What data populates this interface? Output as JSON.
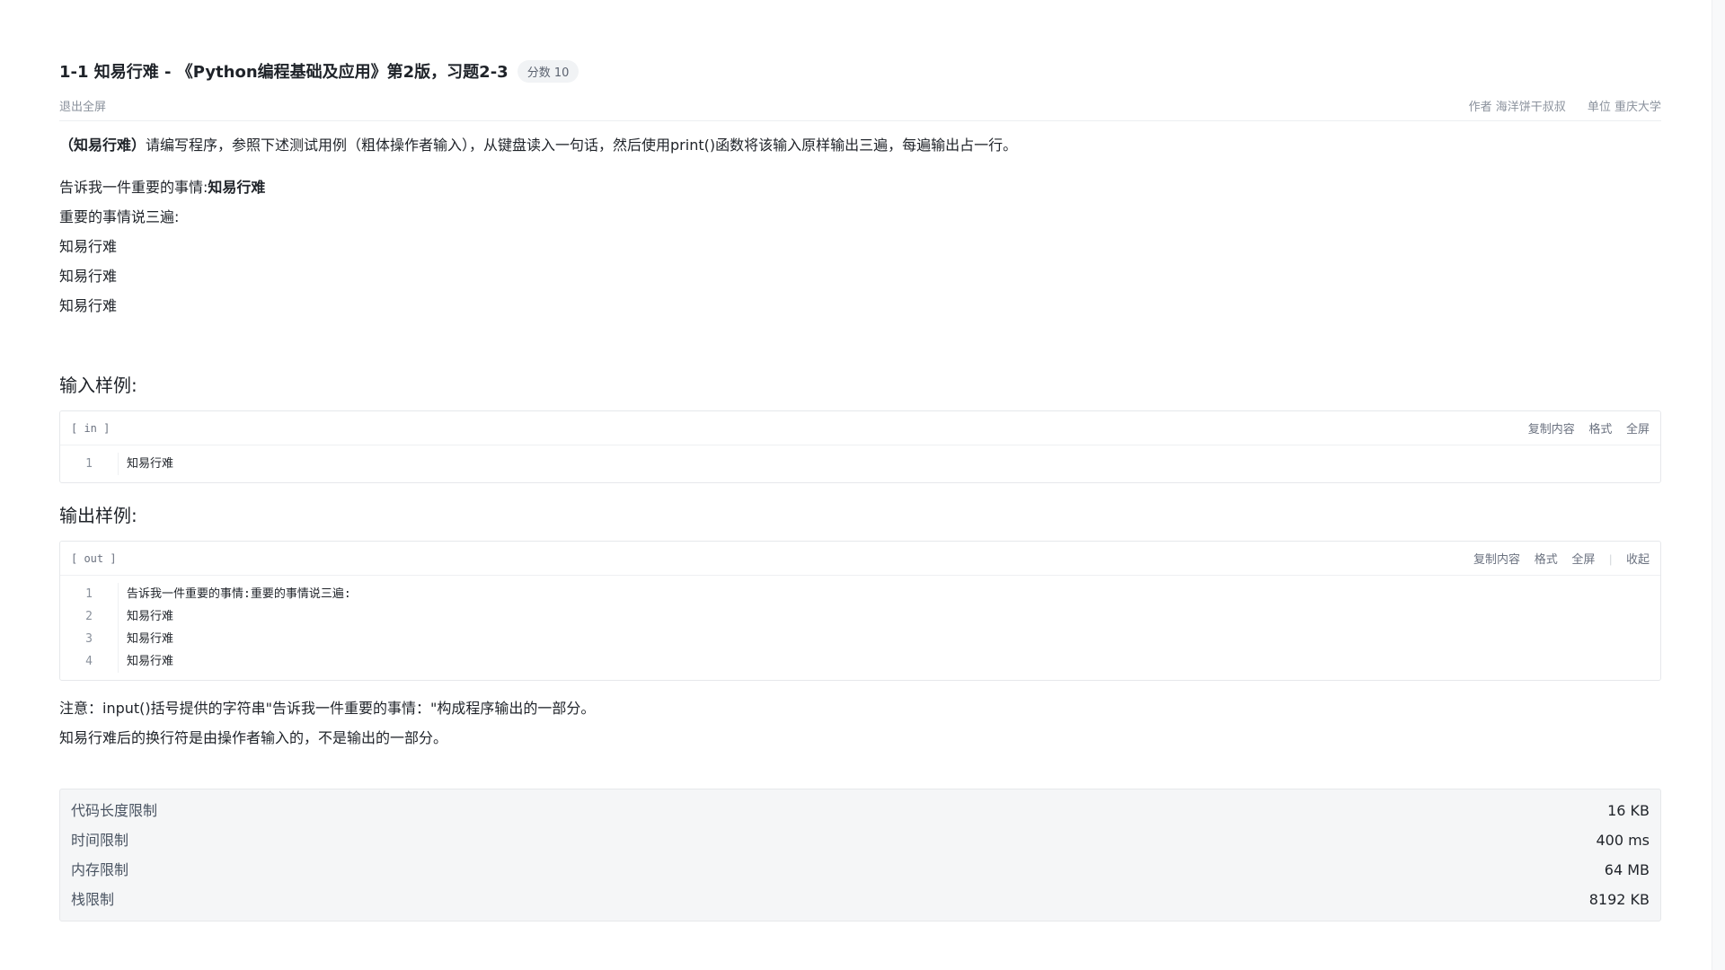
{
  "problem": {
    "title": "1-1 知易行难 - 《Python编程基础及应用》第2版，习题2-3",
    "score_badge": "分数 10",
    "exit_fullscreen": "退出全屏",
    "author": "作者 海洋饼干叔叔",
    "unit": "单位 重庆大学"
  },
  "description": {
    "bold_prefix": "（知易行难）",
    "text": "请编写程序，参照下述测试用例（粗体操作者输入），从键盘读入一句话，然后使用print()函数将该输入原样输出三遍，每遍输出占一行。"
  },
  "example": {
    "line1_prompt": "告诉我一件重要的事情:",
    "line1_input": "知易行难",
    "line2": "重要的事情说三遍:",
    "line3": "知易行难",
    "line4": "知易行难",
    "line5": "知易行难"
  },
  "input_sample": {
    "heading": "输入样例:",
    "tag": "[ in ]",
    "actions": {
      "copy": "复制内容",
      "format": "格式",
      "fullscreen": "全屏"
    },
    "lines": [
      {
        "no": "1",
        "text": "知易行难"
      }
    ]
  },
  "output_sample": {
    "heading": "输出样例:",
    "tag": "[ out ]",
    "actions": {
      "copy": "复制内容",
      "format": "格式",
      "fullscreen": "全屏",
      "collapse": "收起"
    },
    "lines": [
      {
        "no": "1",
        "text": "告诉我一件重要的事情:重要的事情说三遍:"
      },
      {
        "no": "2",
        "text": "知易行难"
      },
      {
        "no": "3",
        "text": "知易行难"
      },
      {
        "no": "4",
        "text": "知易行难"
      }
    ]
  },
  "notes": {
    "note1": "注意：input()括号提供的字符串\"告诉我一件重要的事情：\"构成程序输出的一部分。",
    "note2": "知易行难后的换行符是由操作者输入的，不是输出的一部分。"
  },
  "limits": [
    {
      "label": "代码长度限制",
      "value": "16 KB"
    },
    {
      "label": "时间限制",
      "value": "400 ms"
    },
    {
      "label": "内存限制",
      "value": "64 MB"
    },
    {
      "label": "栈限制",
      "value": "8192 KB"
    }
  ]
}
